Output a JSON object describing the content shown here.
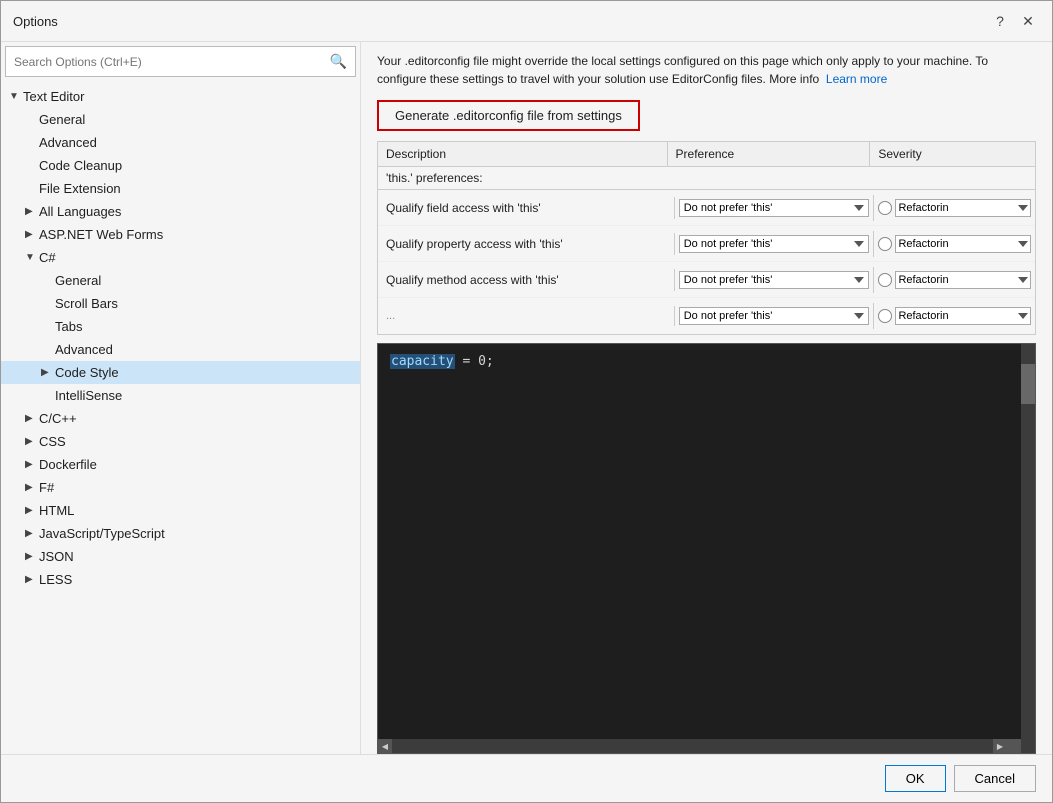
{
  "dialog": {
    "title": "Options",
    "help_btn": "?",
    "close_btn": "✕"
  },
  "search": {
    "placeholder": "Search Options (Ctrl+E)"
  },
  "tree": {
    "items": [
      {
        "id": "text-editor",
        "label": "Text Editor",
        "indent": 0,
        "arrow": "▼",
        "selected": false
      },
      {
        "id": "general",
        "label": "General",
        "indent": 1,
        "arrow": "",
        "selected": false
      },
      {
        "id": "advanced",
        "label": "Advanced",
        "indent": 1,
        "arrow": "",
        "selected": false
      },
      {
        "id": "code-cleanup",
        "label": "Code Cleanup",
        "indent": 1,
        "arrow": "",
        "selected": false
      },
      {
        "id": "file-extension",
        "label": "File Extension",
        "indent": 1,
        "arrow": "",
        "selected": false
      },
      {
        "id": "all-languages",
        "label": "All Languages",
        "indent": 1,
        "arrow": "▶",
        "selected": false
      },
      {
        "id": "asp-net",
        "label": "ASP.NET Web Forms",
        "indent": 1,
        "arrow": "▶",
        "selected": false
      },
      {
        "id": "csharp",
        "label": "C#",
        "indent": 1,
        "arrow": "▼",
        "selected": false
      },
      {
        "id": "csharp-general",
        "label": "General",
        "indent": 2,
        "arrow": "",
        "selected": false
      },
      {
        "id": "scroll-bars",
        "label": "Scroll Bars",
        "indent": 2,
        "arrow": "",
        "selected": false
      },
      {
        "id": "tabs",
        "label": "Tabs",
        "indent": 2,
        "arrow": "",
        "selected": false
      },
      {
        "id": "csharp-advanced",
        "label": "Advanced",
        "indent": 2,
        "arrow": "",
        "selected": false
      },
      {
        "id": "code-style",
        "label": "Code Style",
        "indent": 2,
        "arrow": "▶",
        "selected": true
      },
      {
        "id": "intellisense",
        "label": "IntelliSense",
        "indent": 2,
        "arrow": "",
        "selected": false
      },
      {
        "id": "cpp",
        "label": "C/C++",
        "indent": 1,
        "arrow": "▶",
        "selected": false
      },
      {
        "id": "css",
        "label": "CSS",
        "indent": 1,
        "arrow": "▶",
        "selected": false
      },
      {
        "id": "dockerfile",
        "label": "Dockerfile",
        "indent": 1,
        "arrow": "▶",
        "selected": false
      },
      {
        "id": "fsharp",
        "label": "F#",
        "indent": 1,
        "arrow": "▶",
        "selected": false
      },
      {
        "id": "html",
        "label": "HTML",
        "indent": 1,
        "arrow": "▶",
        "selected": false
      },
      {
        "id": "javascript",
        "label": "JavaScript/TypeScript",
        "indent": 1,
        "arrow": "▶",
        "selected": false
      },
      {
        "id": "json",
        "label": "JSON",
        "indent": 1,
        "arrow": "▶",
        "selected": false
      },
      {
        "id": "less",
        "label": "LESS",
        "indent": 1,
        "arrow": "▶",
        "selected": false
      }
    ]
  },
  "info_text": "Your .editorconfig file might override the local settings configured on this page which only apply to your machine. To configure these settings to travel with your solution use EditorConfig files. More info",
  "learn_more": "Learn more",
  "generate_btn": "Generate .editorconfig file from settings",
  "table": {
    "columns": [
      "Description",
      "Preference",
      "Severity"
    ],
    "section_header": "'this.' preferences:",
    "rows": [
      {
        "desc": "Qualify field access with 'this'",
        "pref": "Do not prefer 'this'",
        "sev": "Refactorin"
      },
      {
        "desc": "Qualify property access with 'this'",
        "pref": "Do not prefer 'this'",
        "sev": "Refactorin"
      },
      {
        "desc": "Qualify method access with 'this'",
        "pref": "Do not prefer 'this'",
        "sev": "Refactorin"
      },
      {
        "desc": "...",
        "pref": "Do not prefer 'this'",
        "sev": "Refactorin"
      }
    ]
  },
  "code_preview": {
    "highlight_word": "capacity",
    "line": " = 0;"
  },
  "footer": {
    "ok_label": "OK",
    "cancel_label": "Cancel"
  }
}
